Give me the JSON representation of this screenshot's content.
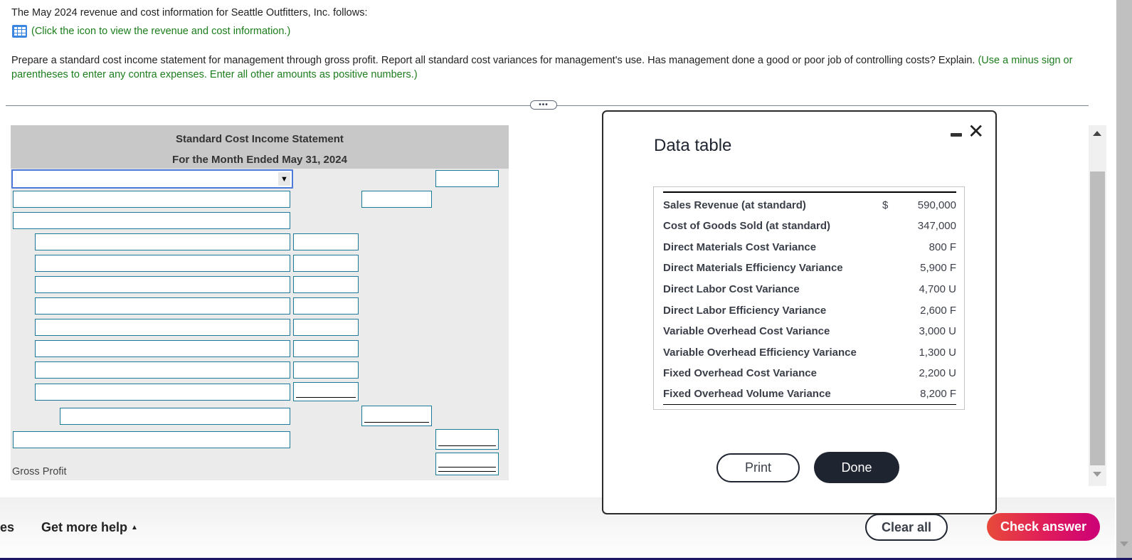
{
  "intro": "The May 2024 revenue and cost information for Seattle Outfitters, Inc. follows:",
  "icon_link": {
    "icon": "data-table-grid-icon",
    "text": "(Click the icon to view the revenue and cost information.)"
  },
  "question": {
    "main": "Prepare a standard cost income statement for management through gross profit. Report all standard cost variances for management's use. Has management done a good or poor job of controlling costs? Explain.",
    "hint": "(Use a minus sign or parentheses to enter any contra expenses. Enter all other amounts as positive numbers.)"
  },
  "expander_label": "•••",
  "statement": {
    "title": "Standard Cost Income Statement",
    "period": "For the Month Ended May 31, 2024",
    "first_row_select_value": "",
    "gross_profit_label": "Gross Profit",
    "select_arrow": "▼"
  },
  "modal": {
    "title": "Data table",
    "minimize_icon": "minimize-icon",
    "close_icon": "✕",
    "rows": [
      {
        "label": "Sales Revenue (at standard)",
        "currency": "$",
        "value": "590,000"
      },
      {
        "label": "Cost of Goods Sold (at standard)",
        "currency": "",
        "value": "347,000"
      },
      {
        "label": "Direct Materials Cost Variance",
        "currency": "",
        "value": "800 F"
      },
      {
        "label": "Direct Materials Efficiency Variance",
        "currency": "",
        "value": "5,900 F"
      },
      {
        "label": "Direct Labor Cost Variance",
        "currency": "",
        "value": "4,700 U"
      },
      {
        "label": "Direct Labor Efficiency Variance",
        "currency": "",
        "value": "2,600 F"
      },
      {
        "label": "Variable Overhead Cost Variance",
        "currency": "",
        "value": "3,000 U"
      },
      {
        "label": "Variable Overhead Efficiency Variance",
        "currency": "",
        "value": "1,300 U"
      },
      {
        "label": "Fixed Overhead Cost Variance",
        "currency": "",
        "value": "2,200 U"
      },
      {
        "label": "Fixed Overhead Volume Variance",
        "currency": "",
        "value": "8,200 F"
      }
    ],
    "print_label": "Print",
    "done_label": "Done"
  },
  "footer": {
    "partial_left": "es",
    "help_label": "Get more help",
    "help_caret": "▲",
    "clear_label": "Clear all",
    "check_label": "Check answer",
    "check_gradient": [
      "#e84a3a",
      "#df1a5c",
      "#cc0077"
    ]
  }
}
